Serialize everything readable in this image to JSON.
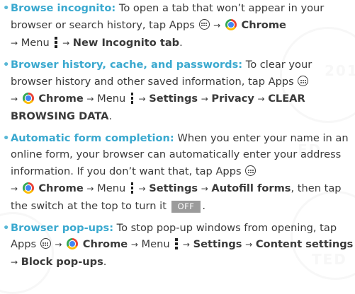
{
  "arrow": "→",
  "watermark": {
    "text_top": "201",
    "text_mid": "ED",
    "text_bot": "TED"
  },
  "items": [
    {
      "term": "Browse incognito:",
      "t1": " To open a tab that won’t appear in your browser or search history, tap Apps",
      "chrome": "Chrome",
      "menu": "Menu",
      "s1": "New Incognito tab",
      "end": "."
    },
    {
      "term": "Browser history, cache, and passwords:",
      "t1": " To clear your browser history and other saved information, tap Apps",
      "chrome": "Chrome",
      "menu": "Menu",
      "s1": "Settings",
      "s2": "Privacy",
      "s3": "CLEAR BROWSING DATA",
      "end": "."
    },
    {
      "term": "Automatic form completion:",
      "t1": " When you enter your name in an online form, your browser can automatically enter your address information. If you don’t want that, tap Apps",
      "chrome": "Chrome",
      "menu": "Menu",
      "s1": "Settings",
      "s2": "Autofill forms",
      "t2": ", then tap the switch at the top to turn it",
      "off": "OFF",
      "end": "."
    },
    {
      "term": "Browser pop-ups:",
      "t1": " To stop pop-up windows from opening, tap Apps",
      "chrome": "Chrome",
      "menu": "Menu",
      "s1": "Settings",
      "s2": "Content settings",
      "s3": "Block pop-ups",
      "end": "."
    }
  ],
  "colors": {
    "term": "#3ba9cf",
    "text": "#3a3a3a",
    "switch_off": "#9b9b9b"
  },
  "icons": {
    "apps": "apps-icon",
    "chrome": "chrome-icon",
    "menu": "menu-icon"
  }
}
